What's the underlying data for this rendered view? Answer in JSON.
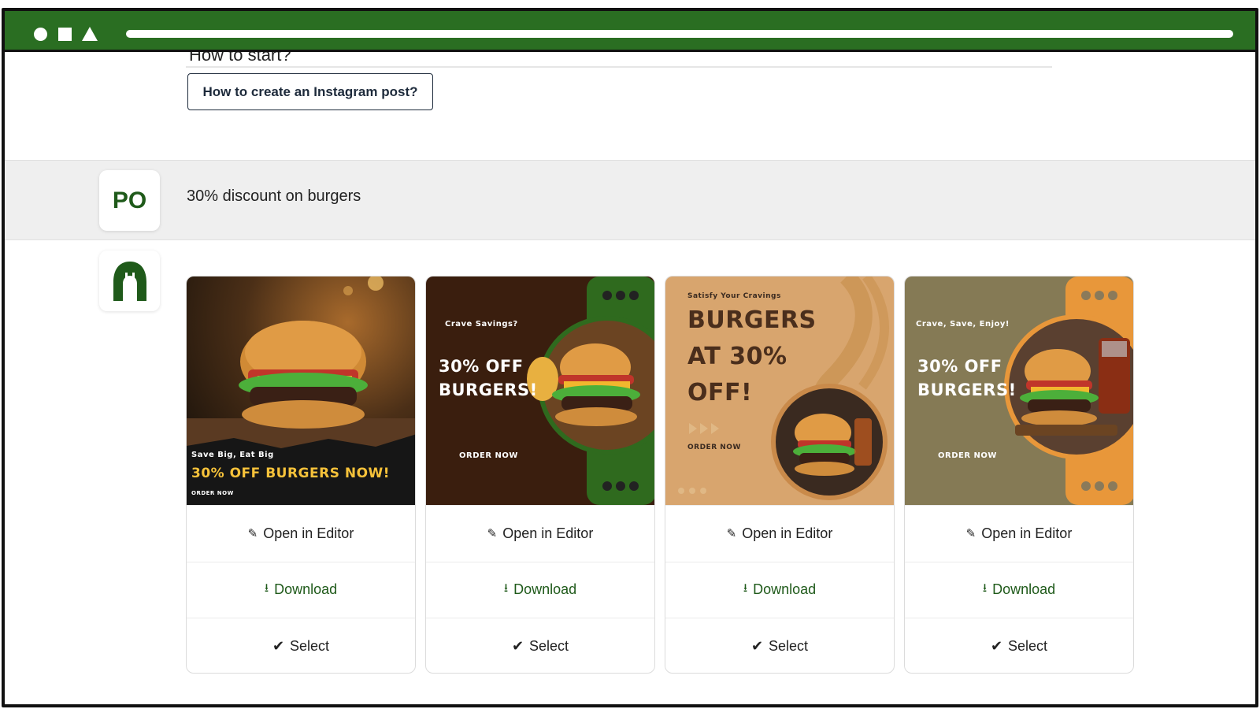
{
  "conversation": {
    "previous_item_label": "How to start?",
    "howto_button_label": "How to create an Instagram post?",
    "user_avatar_initials": "PO",
    "user_prompt": "30% discount on burgers"
  },
  "cards": [
    {
      "poster_kicker": "Save Big, Eat Big",
      "poster_headline": "30% OFF BURGERS NOW!",
      "poster_cta": "ORDER NOW",
      "open_label": "Open in Editor",
      "download_label": "Download",
      "select_label": "Select"
    },
    {
      "poster_kicker": "Crave Savings?",
      "poster_headline_1": "30% OFF",
      "poster_headline_2": "BURGERS!",
      "poster_cta": "ORDER NOW",
      "open_label": "Open in Editor",
      "download_label": "Download",
      "select_label": "Select"
    },
    {
      "poster_kicker": "Satisfy Your Cravings",
      "poster_headline_1": "BURGERS",
      "poster_headline_2": "AT 30%",
      "poster_headline_3": "OFF!",
      "poster_cta": "ORDER NOW",
      "open_label": "Open in Editor",
      "download_label": "Download",
      "select_label": "Select"
    },
    {
      "poster_kicker": "Crave, Save, Enjoy!",
      "poster_headline_1": "30% OFF",
      "poster_headline_2": "BURGERS!",
      "poster_cta": "ORDER NOW",
      "open_label": "Open in Editor",
      "download_label": "Download",
      "select_label": "Select"
    }
  ],
  "icons": {
    "open": "pencil-icon",
    "download": "download-icon",
    "select": "check-icon"
  },
  "colors": {
    "brand_green": "#2a6e22",
    "dark_green": "#1f5a1a",
    "poster2_bg": "#3a1e0e",
    "poster3_bg": "#d8a56e",
    "poster4_bg": "#857a55",
    "poster4_accent": "#e8973a"
  }
}
